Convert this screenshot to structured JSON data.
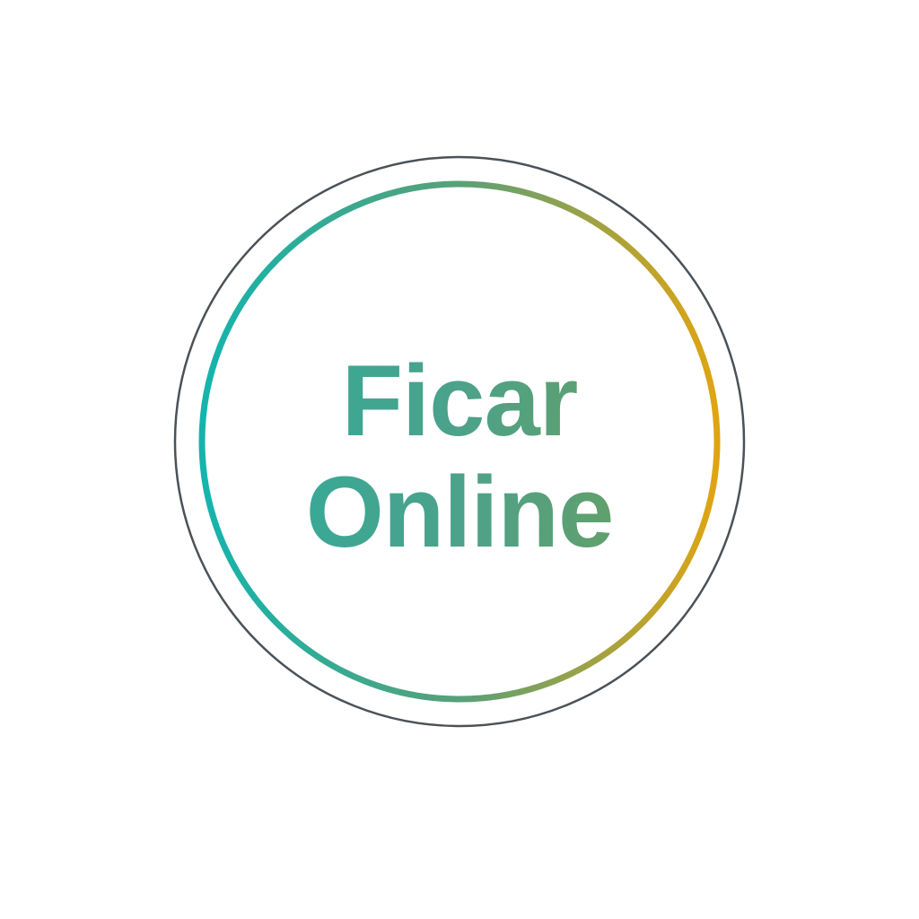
{
  "logo": {
    "line1": "Ficar",
    "line2": "Online",
    "colors": {
      "background": "#ffffff",
      "outer_ring": "#4a5258",
      "inner_ring_start": "#14b4ad",
      "inner_ring_end": "#e0a412",
      "text_start": "#14b4ad",
      "text_end": "#8a9a30"
    }
  }
}
